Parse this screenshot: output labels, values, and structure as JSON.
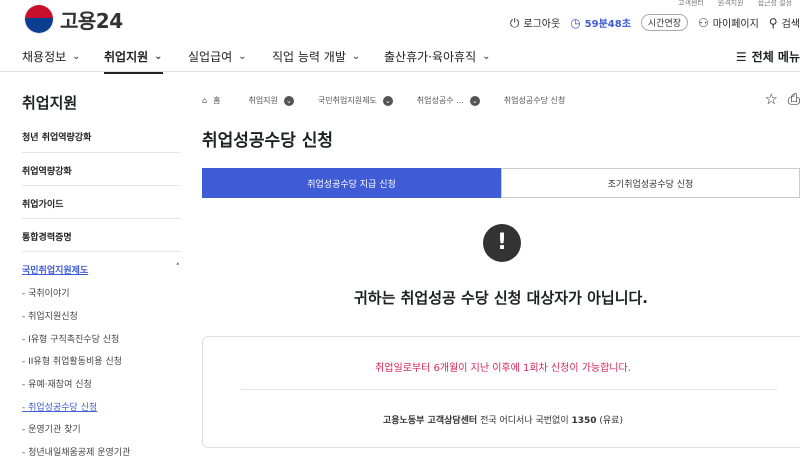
{
  "util_links": [
    "고객센터",
    "원격지원",
    "접근성 설정"
  ],
  "logo": {
    "text": "고용24"
  },
  "session": {
    "logout_label": "로그아웃",
    "timer": "59분48초",
    "extend_label": "시간연장"
  },
  "header_links": {
    "mypage": "마이페이지",
    "search": "검색"
  },
  "gnb": {
    "items": [
      "채용정보",
      "취업지원",
      "실업급여",
      "직업 능력 개발",
      "출산휴가·육아휴직"
    ],
    "menu_all": "전체 메뉴"
  },
  "sidebar": {
    "title": "취업지원",
    "items": [
      "청년 취업역량강화",
      "취업역량강화",
      "취업가이드",
      "통합경력증명",
      "국민취업지원제도"
    ],
    "sub_items": [
      "국취이야기",
      "취업지원신청",
      "I유형 구직촉진수당 신청",
      "II유형 취업활동비용 신청",
      "유예·재참여 신청",
      "취업성공수당 신청",
      "운영기관 찾기",
      "청년내일채움공제 운영기관"
    ]
  },
  "breadcrumb": {
    "home": "홈",
    "items": [
      "취업지원",
      "국민취업지원제도",
      "취업성공수 ...",
      "취업성공수당 신청"
    ]
  },
  "page": {
    "title": "취업성공수당 신청",
    "tabs": [
      "취업성공수당 지급 신청",
      "조기취업성공수당 신청"
    ],
    "alert_icon": "!",
    "message": "귀하는 취업성공 수당 신청 대상자가 아닙니다.",
    "info_red": "취업일로부터 6개월이 지난 이후에 1회차 신청이 가능합니다.",
    "contact_bold": "고용노동부 고객상담센터",
    "contact_rest": " 전국 어디서나 국번없이 ",
    "contact_number": "1350",
    "contact_tail": " (유료)"
  },
  "colors": {
    "accent": "#3f5bd6",
    "alert_text": "#d6245a"
  }
}
